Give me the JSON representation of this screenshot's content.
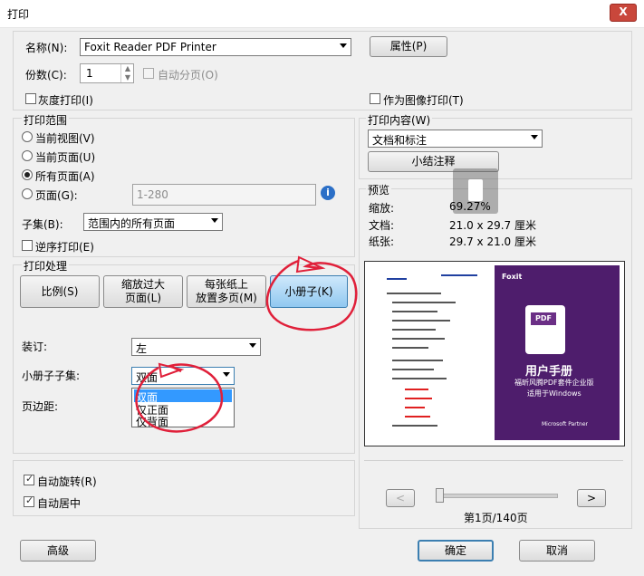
{
  "window": {
    "title": "打印",
    "close_label": "X"
  },
  "printer": {
    "name_label": "名称(N):",
    "name_value": "Foxit Reader PDF Printer",
    "properties_button": "属性(P)",
    "copies_label": "份数(C):",
    "copies_value": "1",
    "collate_label": "自动分页(O)",
    "grayscale_label": "灰度打印(I)",
    "print_as_image_label": "作为图像打印(T)"
  },
  "print_range": {
    "title": "打印范围",
    "options": [
      "当前视图(V)",
      "当前页面(U)",
      "所有页面(A)",
      "页面(G):"
    ],
    "selected_index": 2,
    "pages_placeholder": "1-280",
    "subset_label": "子集(B):",
    "subset_value": "范围内的所有页面",
    "reverse_label": "逆序打印(E)"
  },
  "print_handling": {
    "title": "打印处理",
    "buttons": [
      "比例(S)",
      "缩放过大\n页面(L)",
      "每张纸上\n放置多页(M)",
      "小册子(K)"
    ],
    "active_index": 3,
    "binding_label": "装订:",
    "binding_value": "左",
    "booklet_subset_label": "小册子子集:",
    "booklet_subset_value": "双面",
    "booklet_options": [
      "双面",
      "仅正面",
      "仅背面"
    ],
    "margin_label": "页边距:"
  },
  "options": {
    "auto_rotate_label": "自动旋转(R)",
    "auto_center_label": "自动居中"
  },
  "print_content": {
    "title": "打印内容(W)",
    "value": "文档和标注",
    "summarize_button": "小结注释"
  },
  "preview": {
    "title": "预览",
    "zoom_label": "缩放:",
    "zoom_value": "69.27%",
    "document_label": "文档:",
    "document_value": "21.0 x 29.7 厘米",
    "paper_label": "纸张:",
    "paper_value": "29.7 x 21.0 厘米",
    "page_indicator": "第1页/140页",
    "prev_label": "<",
    "next_label": ">",
    "cover_logo": "Foxit",
    "cover_pdf": "PDF",
    "cover_title": "用户手册",
    "cover_sub1": "福昕风腾PDF套件企业版",
    "cover_sub2": "适用于Windows",
    "cover_partner": "Microsoft Partner"
  },
  "footer": {
    "advanced_button": "高级",
    "ok_button": "确定",
    "cancel_button": "取消"
  }
}
